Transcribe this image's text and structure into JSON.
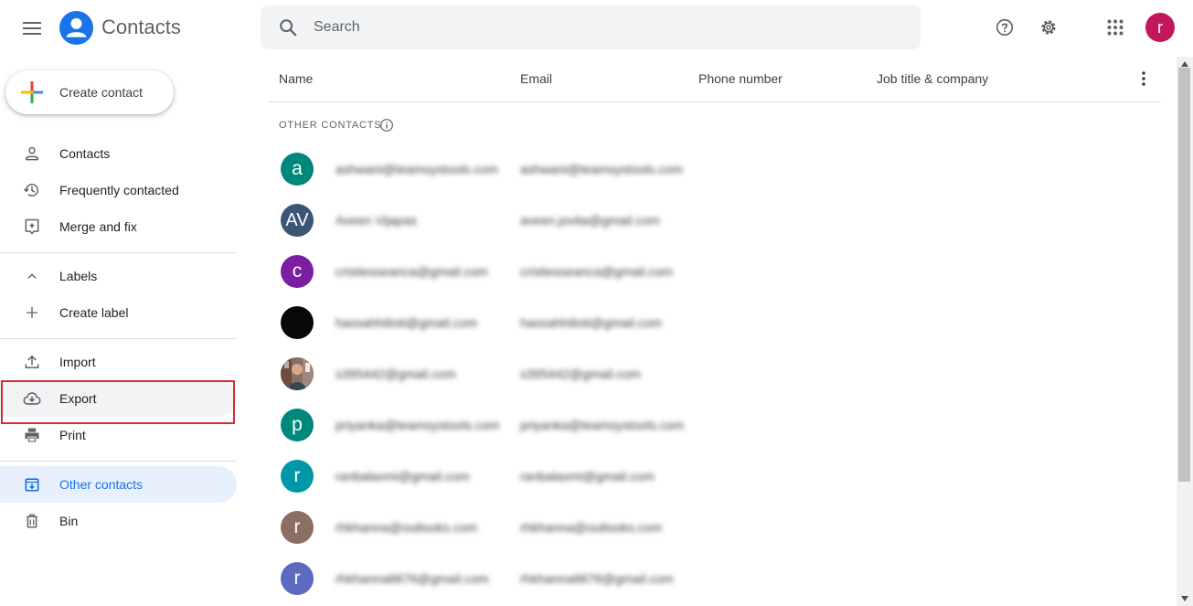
{
  "header": {
    "app_title": "Contacts",
    "search_placeholder": "Search",
    "user_initial": "r",
    "icons": [
      "menu-icon",
      "contacts-logo-icon",
      "search-icon",
      "help-icon",
      "settings-icon",
      "apps-grid-icon"
    ]
  },
  "sidebar": {
    "create_label": "Create contact",
    "items": [
      {
        "label": "Contacts",
        "icon": "person-icon"
      },
      {
        "label": "Frequently contacted",
        "icon": "history-icon"
      },
      {
        "label": "Merge and fix",
        "icon": "merge-fix-icon"
      },
      {
        "label": "Labels",
        "icon": "chevron-up-icon"
      },
      {
        "label": "Create label",
        "icon": "plus-icon"
      },
      {
        "label": "Import",
        "icon": "upload-icon"
      },
      {
        "label": "Export",
        "icon": "cloud-download-icon"
      },
      {
        "label": "Print",
        "icon": "print-icon"
      },
      {
        "label": "Other contacts",
        "icon": "other-contacts-icon"
      },
      {
        "label": "Bin",
        "icon": "trash-icon"
      }
    ],
    "active_item": "Other contacts"
  },
  "table": {
    "columns": [
      "Name",
      "Email",
      "Phone number",
      "Job title & company"
    ],
    "section_label": "OTHER CONTACTS",
    "rows": [
      {
        "initial": "a",
        "color": "#00897b",
        "name": "ashwani@teamsystools.com",
        "email": "ashwani@teamsystools.com"
      },
      {
        "initial": "AV",
        "color": "#3b5675",
        "name": "Aveen Vijapas",
        "email": "aveen.jovita@gmail.com"
      },
      {
        "initial": "c",
        "color": "#7b1fa2",
        "name": "cristiesseanca@gmail.com",
        "email": "cristiesseanca@gmail.com"
      },
      {
        "initial": "",
        "color": "#080808",
        "name": "hassahhilioti@gmail.com",
        "email": "hassahhilioti@gmail.com"
      },
      {
        "initial": "",
        "color": "#8d6e63",
        "name": "s395442@gmail.com",
        "email": "s395442@gmail.com"
      },
      {
        "initial": "p",
        "color": "#00897b",
        "name": "priyanka@teamsystools.com",
        "email": "priyanka@teamsystools.com"
      },
      {
        "initial": "r",
        "color": "#0097a7",
        "name": "ranbalaxmi@gmail.com",
        "email": "ranbalaxmi@gmail.com"
      },
      {
        "initial": "r",
        "color": "#8d6e63",
        "name": "rhkhanna@outlooks.com",
        "email": "rhkhanna@outlooks.com"
      },
      {
        "initial": "r",
        "color": "#5c6bc0",
        "name": "rhkhanna8876@gmail.com",
        "email": "rhkhanna8876@gmail.com"
      }
    ]
  },
  "colors": {
    "accent": "#1a73e8",
    "active_bg": "#e8f0fe",
    "highlight_border": "#d32f2f",
    "user_avatar": "#c2185b"
  }
}
